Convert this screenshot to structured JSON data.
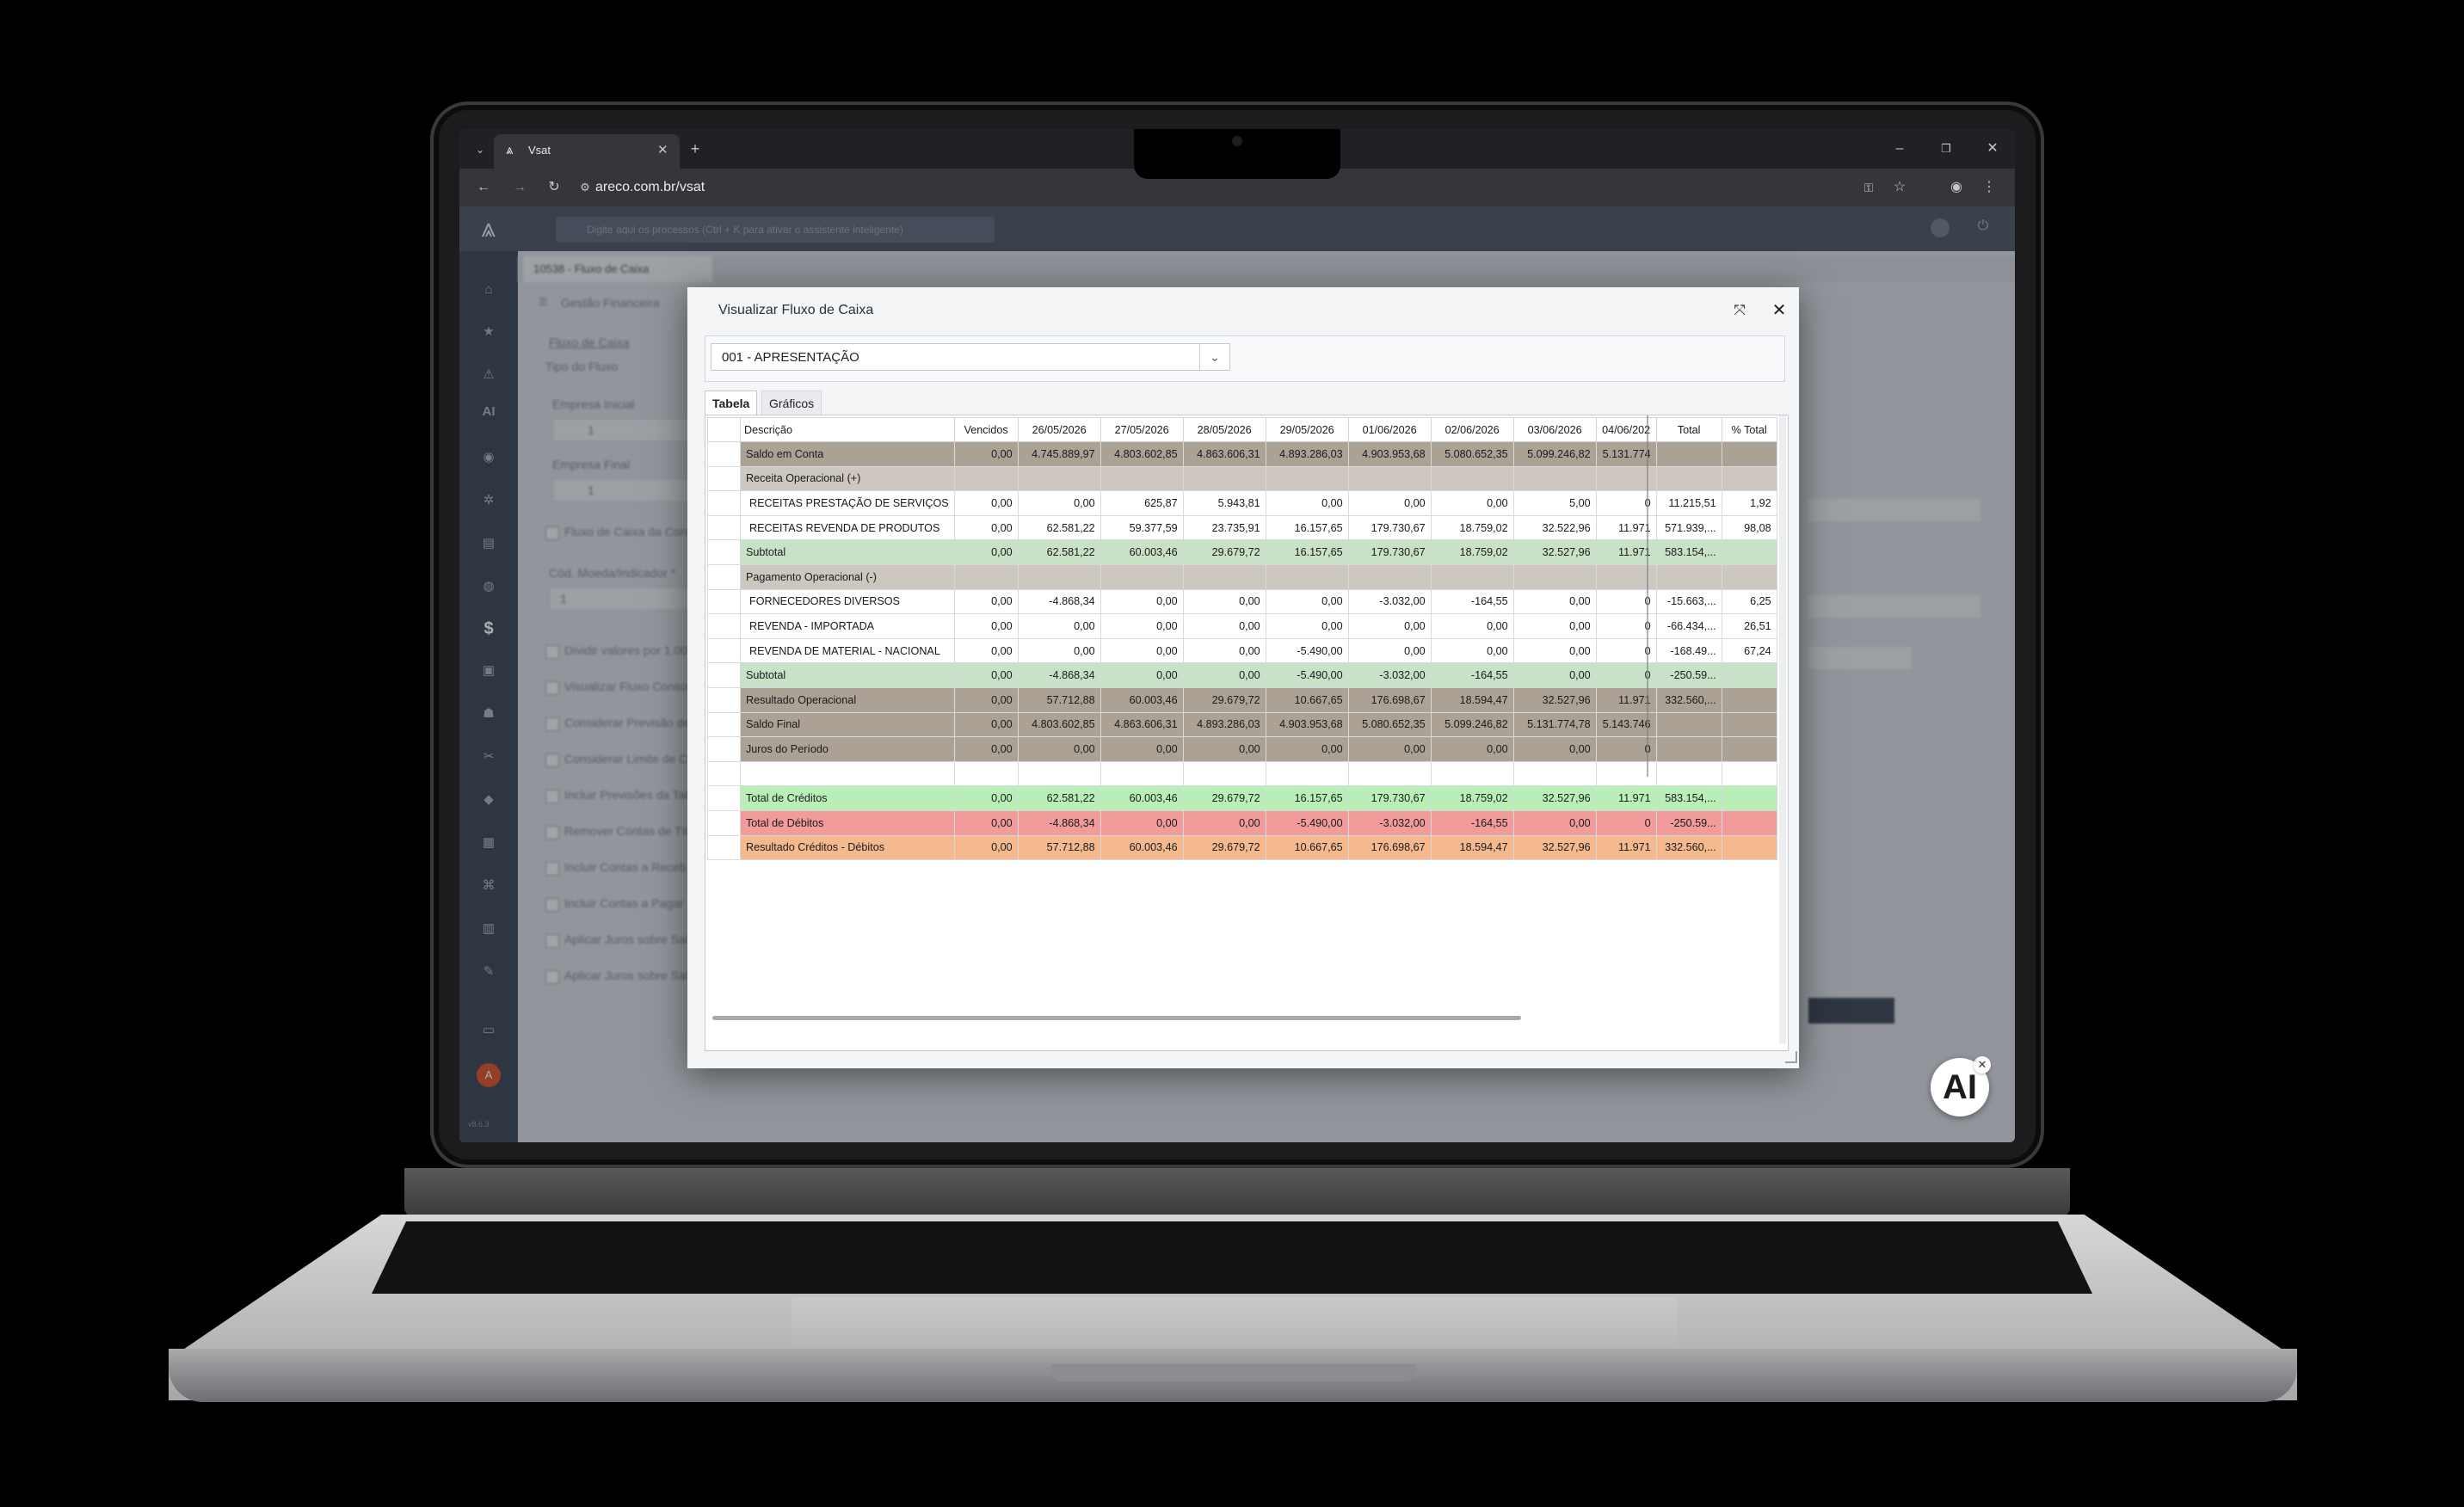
{
  "browser": {
    "tab_title": "Vsat",
    "url": "areco.com.br/vsat"
  },
  "app": {
    "search_placeholder": "Digite aqui os processos (Ctrl + K para ativar o assistente inteligente)",
    "tab_label": "10538 - Fluxo de Caixa",
    "module": "Gestão Financeira",
    "section": "Fluxo de Caixa",
    "field_tipo": "Tipo do Fluxo",
    "field_empresa_inicial": "Empresa Inicial",
    "field_empresa_final": "Empresa Final",
    "empresa_inicial_value": "1",
    "empresa_final_value": "1",
    "cb_fluxo_contas": "Fluxo de Caixa da Conta",
    "field_moeda": "Cód. Moeda/Indicador *",
    "moeda_value": "1",
    "checks": [
      "Dividir valores por 1.00",
      "Visualizar Fluxo Consol",
      "Considerar Previsão de",
      "Considerar Limite de Cr",
      "Incluir Previsões da Tab",
      "Remover Contas de Tít",
      "Incluir Contas a Receb",
      "Incluir Contas a Pagar",
      "Aplicar Juros sobre Sal",
      "Aplicar Juros sobre Sal"
    ],
    "version": "v8.6.3"
  },
  "dialog": {
    "title": "Visualizar Fluxo de Caixa",
    "selected_option": "001 - APRESENTAÇÃO",
    "tabs": [
      "Tabela",
      "Gráficos"
    ],
    "active_tab": "Tabela",
    "columns": [
      "Descrição",
      "Vencidos",
      "26/05/2026",
      "27/05/2026",
      "28/05/2026",
      "29/05/2026",
      "01/06/2026",
      "02/06/2026",
      "03/06/2026",
      "04/06/202",
      "Total",
      "% Total"
    ],
    "rows": [
      {
        "style": "dark",
        "cells": [
          "Saldo em Conta",
          "0,00",
          "4.745.889,97",
          "4.803.602,85",
          "4.863.606,31",
          "4.893.286,03",
          "4.903.953,68",
          "5.080.652,35",
          "5.099.246,82",
          "5.131.774",
          "",
          ""
        ]
      },
      {
        "style": "light",
        "cells": [
          "Receita Operacional (+)",
          "",
          "",
          "",
          "",
          "",
          "",
          "",
          "",
          "",
          "",
          ""
        ]
      },
      {
        "style": "white",
        "cells": [
          "RECEITAS PRESTAÇÃO DE SERVIÇOS",
          "0,00",
          "0,00",
          "625,87",
          "5.943,81",
          "0,00",
          "0,00",
          "0,00",
          "5,00",
          "0",
          "11.215,51",
          "1,92"
        ]
      },
      {
        "style": "white",
        "cells": [
          "RECEITAS REVENDA DE PRODUTOS",
          "0,00",
          "62.581,22",
          "59.377,59",
          "23.735,91",
          "16.157,65",
          "179.730,67",
          "18.759,02",
          "32.522,96",
          "11.971",
          "571.939,...",
          "98,08"
        ]
      },
      {
        "style": "green",
        "cells": [
          "Subtotal",
          "0,00",
          "62.581,22",
          "60.003,46",
          "29.679,72",
          "16.157,65",
          "179.730,67",
          "18.759,02",
          "32.527,96",
          "11.971",
          "583.154,...",
          ""
        ]
      },
      {
        "style": "light",
        "cells": [
          "Pagamento Operacional (-)",
          "",
          "",
          "",
          "",
          "",
          "",
          "",
          "",
          "",
          "",
          ""
        ]
      },
      {
        "style": "white",
        "cells": [
          "FORNECEDORES DIVERSOS",
          "0,00",
          "-4.868,34",
          "0,00",
          "0,00",
          "0,00",
          "-3.032,00",
          "-164,55",
          "0,00",
          "0",
          "-15.663,...",
          "6,25"
        ]
      },
      {
        "style": "white",
        "cells": [
          "REVENDA - IMPORTADA",
          "0,00",
          "0,00",
          "0,00",
          "0,00",
          "0,00",
          "0,00",
          "0,00",
          "0,00",
          "0",
          "-66.434,...",
          "26,51"
        ]
      },
      {
        "style": "white",
        "cells": [
          "REVENDA DE MATERIAL - NACIONAL",
          "0,00",
          "0,00",
          "0,00",
          "0,00",
          "-5.490,00",
          "0,00",
          "0,00",
          "0,00",
          "0",
          "-168.49...",
          "67,24"
        ]
      },
      {
        "style": "green",
        "cells": [
          "Subtotal",
          "0,00",
          "-4.868,34",
          "0,00",
          "0,00",
          "-5.490,00",
          "-3.032,00",
          "-164,55",
          "0,00",
          "0",
          "-250.59...",
          ""
        ]
      },
      {
        "style": "dark",
        "cells": [
          "Resultado Operacional",
          "0,00",
          "57.712,88",
          "60.003,46",
          "29.679,72",
          "10.667,65",
          "176.698,67",
          "18.594,47",
          "32.527,96",
          "11.971",
          "332.560,...",
          ""
        ]
      },
      {
        "style": "dark",
        "cells": [
          "Saldo Final",
          "0,00",
          "4.803.602,85",
          "4.863.606,31",
          "4.893.286,03",
          "4.903.953,68",
          "5.080.652,35",
          "5.099.246,82",
          "5.131.774,78",
          "5.143.746",
          "",
          ""
        ]
      },
      {
        "style": "dark",
        "cells": [
          "Juros do Período",
          "0,00",
          "0,00",
          "0,00",
          "0,00",
          "0,00",
          "0,00",
          "0,00",
          "0,00",
          "0",
          "",
          ""
        ]
      },
      {
        "style": "white",
        "cells": [
          "",
          "",
          "",
          "",
          "",
          "",
          "",
          "",
          "",
          "",
          "",
          ""
        ]
      },
      {
        "style": "tgreen",
        "cells": [
          "Total de Créditos",
          "0,00",
          "62.581,22",
          "60.003,46",
          "29.679,72",
          "16.157,65",
          "179.730,67",
          "18.759,02",
          "32.527,96",
          "11.971",
          "583.154,...",
          ""
        ]
      },
      {
        "style": "red",
        "cells": [
          "Total de Débitos",
          "0,00",
          "-4.868,34",
          "0,00",
          "0,00",
          "-5.490,00",
          "-3.032,00",
          "-164,55",
          "0,00",
          "0",
          "-250.59...",
          ""
        ]
      },
      {
        "style": "orange",
        "cells": [
          "Resultado Créditos - Débitos",
          "0,00",
          "57.712,88",
          "60.003,46",
          "29.679,72",
          "10.667,65",
          "176.698,67",
          "18.594,47",
          "32.527,96",
          "11.971",
          "332.560,...",
          ""
        ]
      }
    ]
  },
  "ai_badge": "AI",
  "colors": {
    "row_dark": "#aca195",
    "row_light": "#cdc7c0",
    "subtotal": "#c8e2c7",
    "total_credit": "#b9efb7",
    "total_debit": "#f19b9b",
    "result": "#f4b98e"
  }
}
